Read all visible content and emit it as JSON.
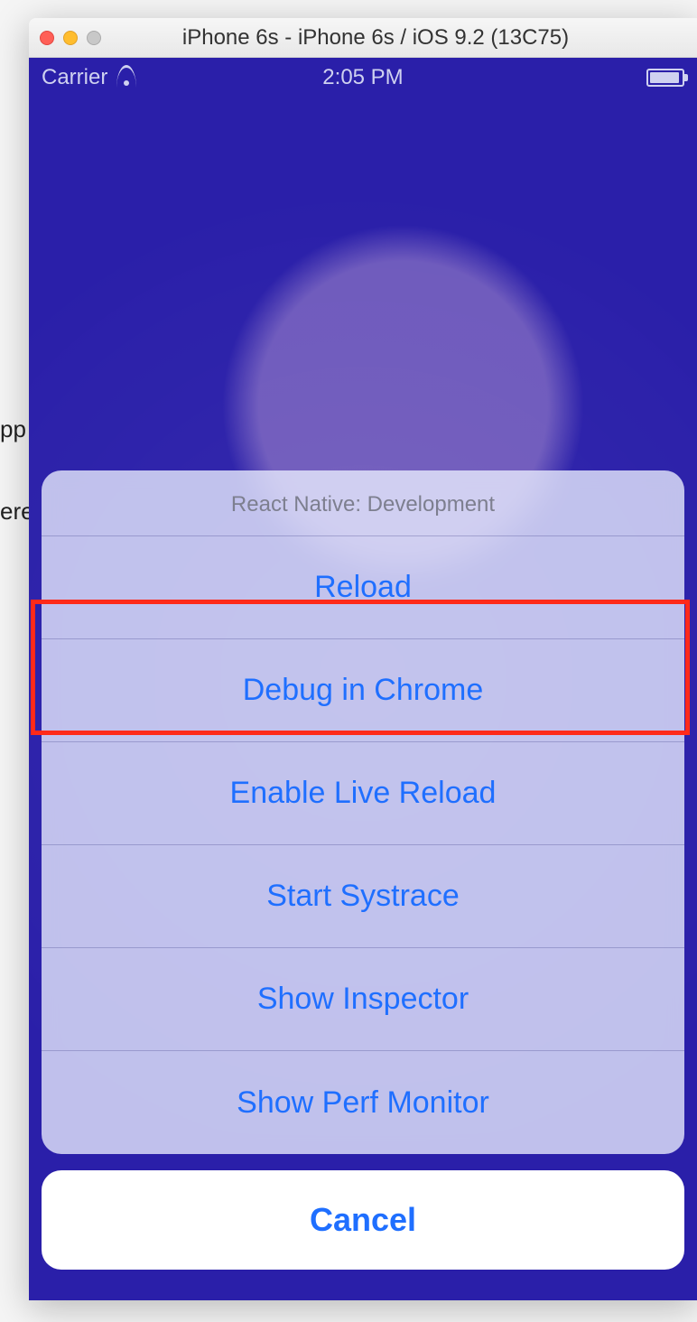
{
  "window": {
    "title": "iPhone 6s - iPhone 6s / iOS 9.2 (13C75)"
  },
  "statusbar": {
    "carrier": "Carrier",
    "time": "2:05 PM"
  },
  "actionsheet": {
    "title": "React Native: Development",
    "items": [
      {
        "label": "Reload"
      },
      {
        "label": "Debug in Chrome",
        "highlighted": true
      },
      {
        "label": "Enable Live Reload"
      },
      {
        "label": "Start Systrace"
      },
      {
        "label": "Show Inspector"
      },
      {
        "label": "Show Perf Monitor"
      }
    ],
    "cancel": "Cancel"
  },
  "bg_fragments": [
    "pp",
    "ere"
  ]
}
